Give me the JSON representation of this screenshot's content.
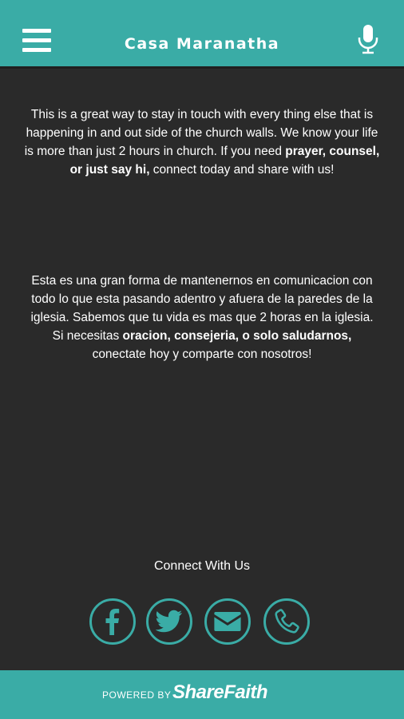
{
  "header": {
    "title": "Casa Maranatha",
    "menu_icon": "hamburger-menu-icon",
    "mic_icon": "microphone-icon"
  },
  "main": {
    "english": {
      "part1": "This is a great way to stay in touch with every thing else that is happening in and out side of the church walls. We know your life is more than just 2 hours in church. If you need ",
      "bold": "prayer, counsel, or just say hi,",
      "part2": " connect today and share with us!"
    },
    "spanish": {
      "part1": "Esta es una gran forma de mantenernos en comunicacion con todo lo que esta pasando adentro y afuera de la paredes de la iglesia. Sabemos que tu vida es mas que 2 horas en la iglesia.  Si necesitas ",
      "bold": "oracion, consejeria, o solo saludarnos,",
      "part2": " conectate hoy y comparte con nosotros!"
    },
    "connect_label": "Connect With Us",
    "social_icons": [
      "facebook-icon",
      "twitter-icon",
      "email-icon",
      "phone-icon"
    ]
  },
  "footer": {
    "powered_by": "POWERED BY",
    "brand": "ShareFaith"
  },
  "colors": {
    "accent": "#3aaca6",
    "background": "#2a2a2a",
    "text": "#ffffff"
  }
}
